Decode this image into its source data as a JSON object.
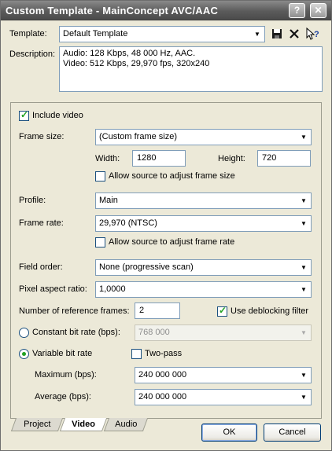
{
  "window": {
    "title": "Custom Template - MainConcept AVC/AAC",
    "help_glyph": "?",
    "close_glyph": "✕"
  },
  "template": {
    "label": "Template:",
    "value": "Default Template"
  },
  "description": {
    "label": "Description:",
    "lines": [
      "Audio: 128 Kbps, 48 000 Hz, AAC.",
      "Video: 512 Kbps, 29,970 fps, 320x240"
    ]
  },
  "video": {
    "include_video_label": "Include video",
    "frame_size_label": "Frame size:",
    "frame_size_value": "(Custom frame size)",
    "width_label": "Width:",
    "width_value": "1280",
    "height_label": "Height:",
    "height_value": "720",
    "allow_frame_size_label": "Allow source to adjust frame size",
    "profile_label": "Profile:",
    "profile_value": "Main",
    "frame_rate_label": "Frame rate:",
    "frame_rate_value": "29,970 (NTSC)",
    "allow_frame_rate_label": "Allow source to adjust frame rate",
    "field_order_label": "Field order:",
    "field_order_value": "None (progressive scan)",
    "pixel_aspect_label": "Pixel aspect ratio:",
    "pixel_aspect_value": "1,0000",
    "ref_frames_label": "Number of reference frames:",
    "ref_frames_value": "2",
    "deblocking_label": "Use deblocking filter",
    "cbr_label": "Constant bit rate (bps):",
    "cbr_value": "768 000",
    "vbr_label": "Variable bit rate",
    "two_pass_label": "Two-pass",
    "maximum_label": "Maximum (bps):",
    "maximum_value": "240 000 000",
    "average_label": "Average (bps):",
    "average_value": "240 000 000"
  },
  "tabs": [
    {
      "label": "Project"
    },
    {
      "label": "Video"
    },
    {
      "label": "Audio"
    }
  ],
  "buttons": {
    "ok": "OK",
    "cancel": "Cancel"
  },
  "icons": {
    "save": "floppy-disk-icon",
    "delete": "delete-x-icon",
    "help": "whats-this-help-icon"
  }
}
